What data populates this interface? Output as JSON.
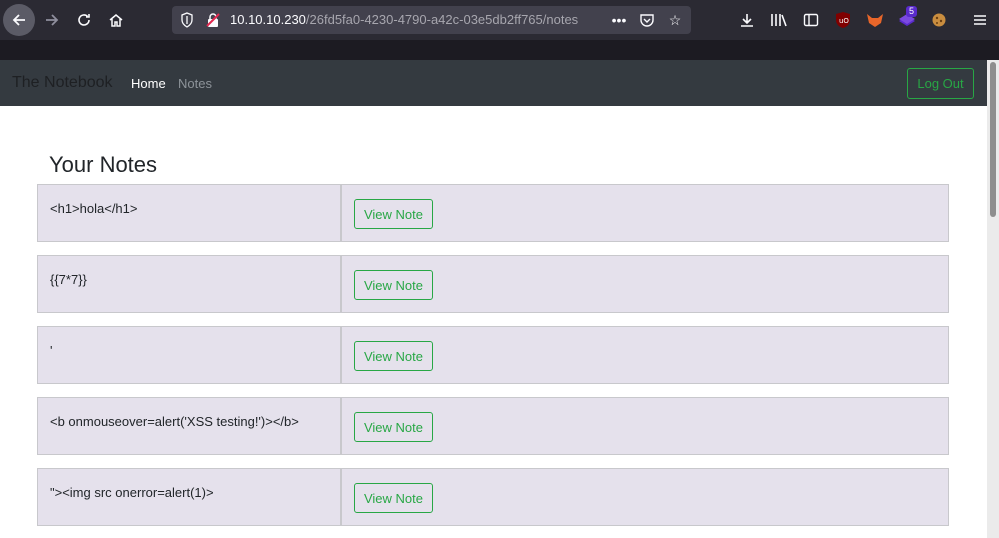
{
  "browser": {
    "url_host": "10.10.10.230",
    "url_path": "/26fd5fa0-4230-4790-a42c-03e5db2ff765/notes",
    "extension_badge": "5"
  },
  "navbar": {
    "brand": "The Notebook",
    "links": [
      {
        "label": "Home"
      },
      {
        "label": "Notes"
      }
    ],
    "logout_label": "Log Out"
  },
  "main": {
    "title": "Your Notes",
    "notes": [
      {
        "text": "<h1>hola</h1>",
        "button_label": "View Note"
      },
      {
        "text": "{{7*7}}",
        "button_label": "View Note"
      },
      {
        "text": "'",
        "button_label": "View Note"
      },
      {
        "text": "<b onmouseover=alert('XSS testing!')></b>",
        "button_label": "View Note"
      },
      {
        "text": "\"><img src onerror=alert(1)>",
        "button_label": "View Note"
      }
    ]
  },
  "colors": {
    "navbar_bg": "#343a40",
    "accent_green": "#28a745",
    "row_bg": "#e5e1ec"
  }
}
